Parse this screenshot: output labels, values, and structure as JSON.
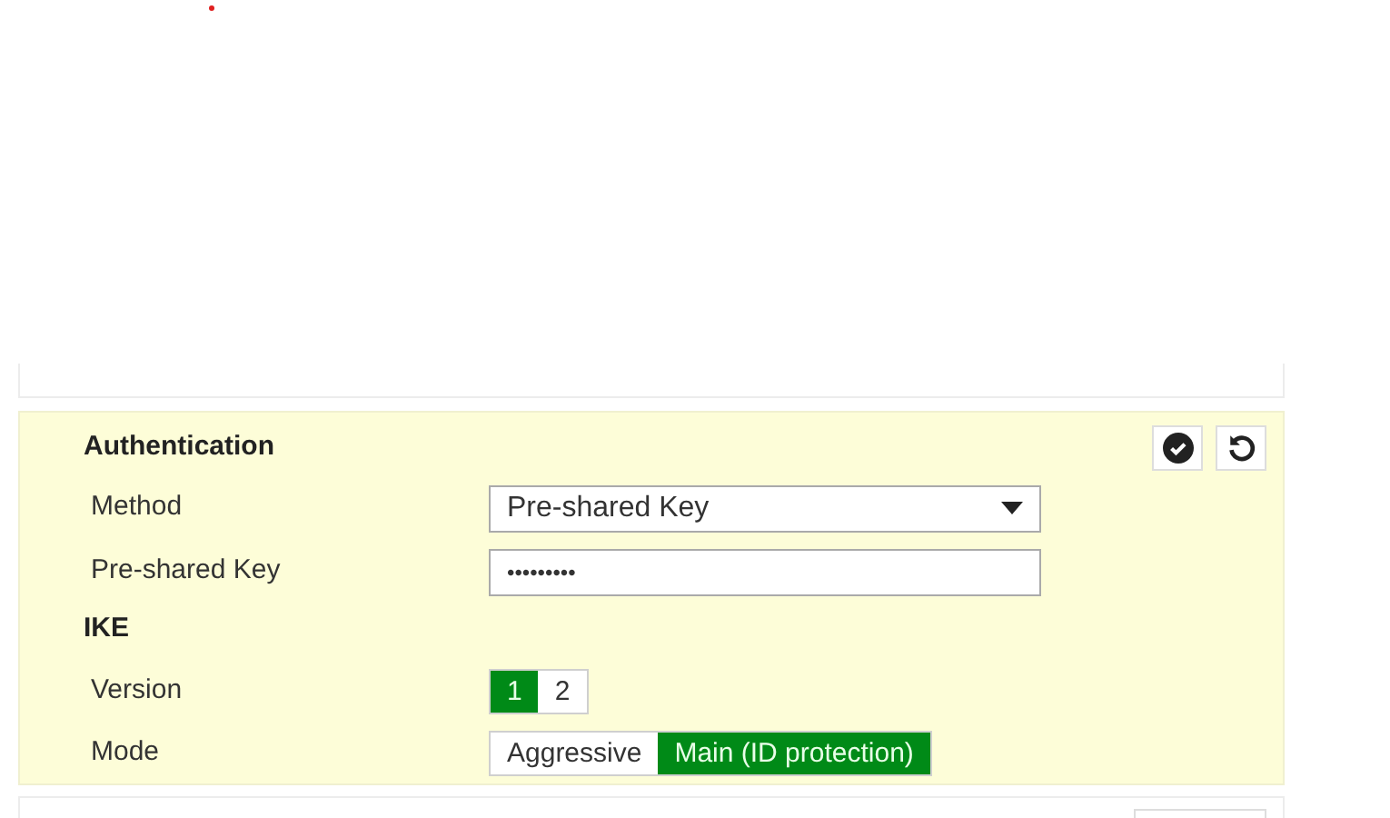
{
  "authentication": {
    "title": "Authentication",
    "method": {
      "label": "Method",
      "value": "Pre-shared Key"
    },
    "key": {
      "label": "Pre-shared Key",
      "value": "•••••••••"
    }
  },
  "ike": {
    "title": "IKE",
    "version": {
      "label": "Version",
      "options": [
        {
          "label": "1",
          "selected": true
        },
        {
          "label": "2",
          "selected": false
        }
      ]
    },
    "mode": {
      "label": "Mode",
      "options": [
        {
          "label": "Aggressive",
          "selected": false
        },
        {
          "label": "Main (ID protection)",
          "selected": true
        }
      ]
    }
  }
}
